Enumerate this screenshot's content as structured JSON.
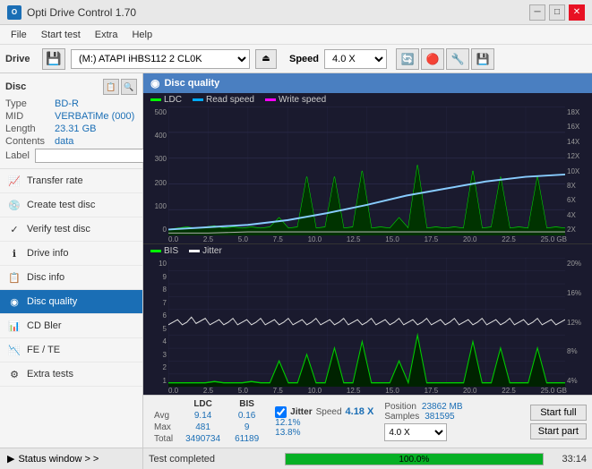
{
  "app": {
    "title": "Opti Drive Control 1.70",
    "icon": "O"
  },
  "title_controls": {
    "minimize": "─",
    "maximize": "□",
    "close": "✕"
  },
  "menu": {
    "items": [
      "File",
      "Start test",
      "Extra",
      "Help"
    ]
  },
  "drive_bar": {
    "label": "Drive",
    "drive_value": "(M:)  ATAPI iHBS112  2 CL0K",
    "speed_label": "Speed",
    "speed_value": "4.0 X"
  },
  "disc": {
    "title": "Disc",
    "type_label": "Type",
    "type_value": "BD-R",
    "mid_label": "MID",
    "mid_value": "VERBATiMe (000)",
    "length_label": "Length",
    "length_value": "23.31 GB",
    "contents_label": "Contents",
    "contents_value": "data",
    "label_label": "Label",
    "label_value": ""
  },
  "nav_items": [
    {
      "id": "transfer-rate",
      "label": "Transfer rate",
      "icon": "📈"
    },
    {
      "id": "create-test-disc",
      "label": "Create test disc",
      "icon": "💿"
    },
    {
      "id": "verify-test-disc",
      "label": "Verify test disc",
      "icon": "✓"
    },
    {
      "id": "drive-info",
      "label": "Drive info",
      "icon": "ℹ"
    },
    {
      "id": "disc-info",
      "label": "Disc info",
      "icon": "📋"
    },
    {
      "id": "disc-quality",
      "label": "Disc quality",
      "icon": "◉",
      "active": true
    },
    {
      "id": "cd-bler",
      "label": "CD Bler",
      "icon": "📊"
    },
    {
      "id": "fe-te",
      "label": "FE / TE",
      "icon": "📉"
    },
    {
      "id": "extra-tests",
      "label": "Extra tests",
      "icon": "⚙"
    }
  ],
  "status_window": {
    "label": "Status window > >"
  },
  "disc_quality": {
    "title": "Disc quality",
    "legend": {
      "ldc": "LDC",
      "read_speed": "Read speed",
      "write_speed": "Write speed"
    },
    "top_chart": {
      "y_labels_left": [
        "500",
        "400",
        "300",
        "200",
        "100",
        "0"
      ],
      "y_labels_right": [
        "18X",
        "16X",
        "14X",
        "12X",
        "10X",
        "8X",
        "6X",
        "4X",
        "2X"
      ],
      "x_labels": [
        "0.0",
        "2.5",
        "5.0",
        "7.5",
        "10.0",
        "12.5",
        "15.0",
        "17.5",
        "20.0",
        "22.5",
        "25.0 GB"
      ]
    },
    "bottom_chart": {
      "title": "BIS",
      "title2": "Jitter",
      "y_labels_left": [
        "10",
        "9",
        "8",
        "7",
        "6",
        "5",
        "4",
        "3",
        "2",
        "1"
      ],
      "y_labels_right": [
        "20%",
        "16%",
        "12%",
        "8%",
        "4%"
      ],
      "x_labels": [
        "0.0",
        "2.5",
        "5.0",
        "7.5",
        "10.0",
        "12.5",
        "15.0",
        "17.5",
        "20.0",
        "22.5",
        "25.0 GB"
      ]
    },
    "stats": {
      "headers": [
        "",
        "LDC",
        "BIS"
      ],
      "avg_label": "Avg",
      "avg_ldc": "9.14",
      "avg_bis": "0.16",
      "max_label": "Max",
      "max_ldc": "481",
      "max_bis": "9",
      "total_label": "Total",
      "total_ldc": "3490734",
      "total_bis": "61189",
      "jitter_label": "Jitter",
      "jitter_checked": true,
      "avg_jitter": "12.1%",
      "max_jitter": "13.8%",
      "speed_label": "Speed",
      "speed_value": "4.18 X",
      "speed_select": "4.0 X",
      "position_label": "Position",
      "position_value": "23862 MB",
      "samples_label": "Samples",
      "samples_value": "381595",
      "start_full_label": "Start full",
      "start_part_label": "Start part"
    }
  },
  "bottom_bar": {
    "status": "Test completed",
    "progress": 100,
    "progress_text": "100.0%",
    "time": "33:14"
  }
}
